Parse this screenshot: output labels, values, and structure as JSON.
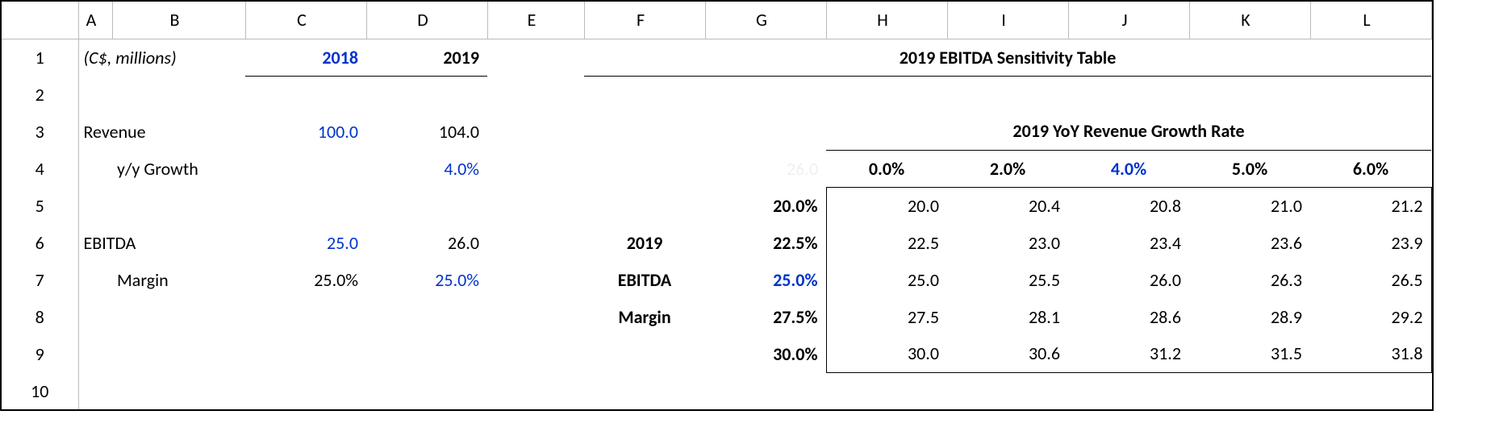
{
  "colHeaders": {
    "A": "A",
    "B": "B",
    "C": "C",
    "D": "D",
    "E": "E",
    "F": "F",
    "G": "G",
    "H": "H",
    "I": "I",
    "J": "J",
    "K": "K",
    "L": "L"
  },
  "rows": [
    "1",
    "2",
    "3",
    "4",
    "5",
    "6",
    "7",
    "8",
    "9",
    "10"
  ],
  "left": {
    "titleNote": "(C$, millions)",
    "year2018": "2018",
    "year2019": "2019",
    "revenueLabel": "Revenue",
    "revenue2018": "100.0",
    "revenue2019": "104.0",
    "yoyGrowthLabel": "y/y Growth",
    "yoyGrowth2019": "4.0%",
    "ebitdaLabel": "EBITDA",
    "ebitda2018": "25.0",
    "ebitda2019": "26.0",
    "marginLabel": "Margin",
    "margin2018": "25.0%",
    "margin2019": "25.0%"
  },
  "sens": {
    "mainTitle": "2019 EBITDA Sensitivity Table",
    "revGrowthTitle": "2019 YoY Revenue Growth Rate",
    "growthHeaders": [
      "0.0%",
      "2.0%",
      "4.0%",
      "5.0%",
      "6.0%"
    ],
    "sideLabelLine1": "2019",
    "sideLabelLine2": "EBITDA",
    "sideLabelLine3": "Margin",
    "hiddenAnchor": "26.0",
    "marginHeaders": [
      "20.0%",
      "22.5%",
      "25.0%",
      "27.5%",
      "30.0%"
    ],
    "dataRows": [
      [
        "20.0",
        "20.4",
        "20.8",
        "21.0",
        "21.2"
      ],
      [
        "22.5",
        "23.0",
        "23.4",
        "23.6",
        "23.9"
      ],
      [
        "25.0",
        "25.5",
        "26.0",
        "26.3",
        "26.5"
      ],
      [
        "27.5",
        "28.1",
        "28.6",
        "28.9",
        "29.2"
      ],
      [
        "30.0",
        "30.6",
        "31.2",
        "31.5",
        "31.8"
      ]
    ]
  }
}
